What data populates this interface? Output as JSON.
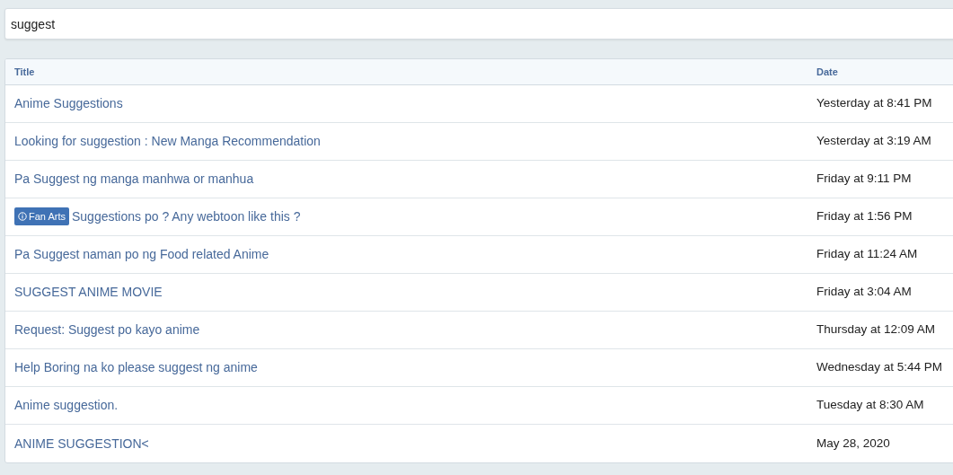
{
  "search": {
    "value": "suggest"
  },
  "table": {
    "columns": [
      "Title",
      "Date"
    ],
    "rows": [
      {
        "title": "Anime Suggestions",
        "date": "Yesterday at 8:41 PM"
      },
      {
        "title": "Looking for suggestion : New Manga Recommendation",
        "date": "Yesterday at 3:19 AM"
      },
      {
        "title": "Pa Suggest ng manga manhwa or manhua",
        "date": "Friday at 9:11 PM"
      },
      {
        "prefix": "Fan Arts",
        "title": "Suggestions po ? Any webtoon like this ?",
        "date": "Friday at 1:56 PM"
      },
      {
        "title": "Pa Suggest naman po ng Food related Anime",
        "date": "Friday at 11:24 AM"
      },
      {
        "title": "SUGGEST ANIME MOVIE",
        "date": "Friday at 3:04 AM"
      },
      {
        "title": "Request: Suggest po kayo anime",
        "date": "Thursday at 12:09 AM"
      },
      {
        "title": "Help Boring na ko please suggest ng anime",
        "date": "Wednesday at 5:44 PM"
      },
      {
        "title": "Anime suggestion.",
        "date": "Tuesday at 8:30 AM"
      },
      {
        "title": "ANIME SUGGESTION<",
        "date": "May 28, 2020"
      }
    ]
  }
}
